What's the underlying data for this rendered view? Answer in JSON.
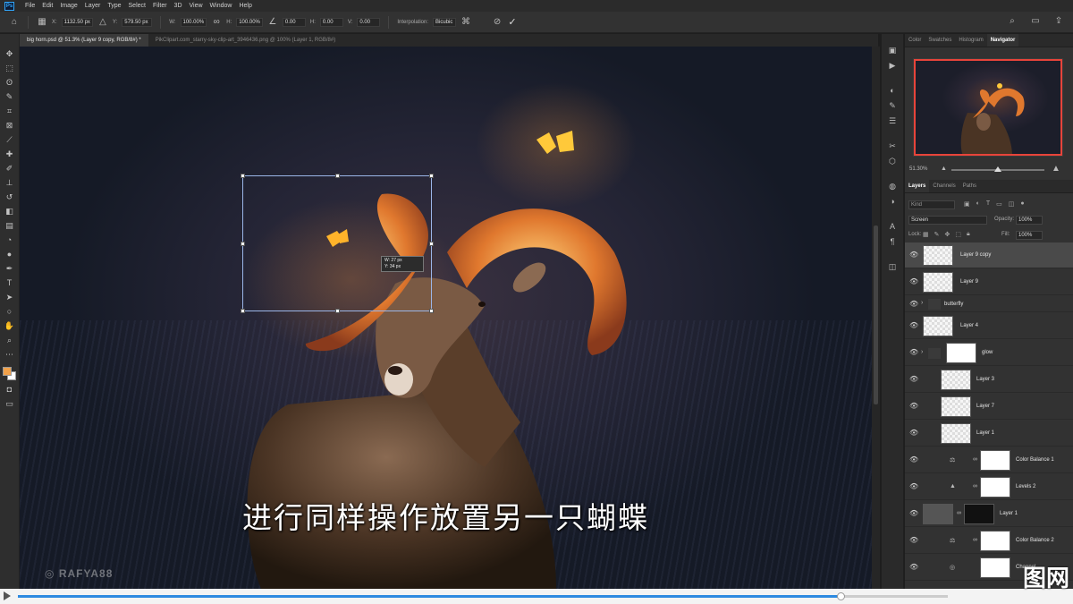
{
  "menubar": {
    "app_icon": "Ps",
    "items": [
      "File",
      "Edit",
      "Image",
      "Layer",
      "Type",
      "Select",
      "Filter",
      "3D",
      "View",
      "Window",
      "Help"
    ]
  },
  "options": {
    "x_value": "1132.50 px",
    "y_value": "579.50 px",
    "w_value": "100.00%",
    "h_value": "100.00%",
    "angle_value": "0.00",
    "h_skew_value": "0.00",
    "v_skew_value": "0.00",
    "interpolation_label": "Interpolation:",
    "interpolation_value": "Bicubic"
  },
  "tabs": [
    "big horn.psd @ 51.3% (Layer 9 copy, RGB/8#) *",
    "PikClipart.com_starry-sky-clip-art_3946436.png @ 100% (Layer 1, RGB/8#)"
  ],
  "canvas": {
    "transform_tip_line1": "W: 27 px",
    "transform_tip_line2": "Y: 34 px",
    "subtitle": "进行同样操作放置另一只蝴蝶",
    "watermark": "RAFYA88"
  },
  "panels": {
    "top_tabs": [
      "Color",
      "Swatches",
      "Histogram",
      "Navigator"
    ],
    "active_top_tab": "Navigator",
    "zoom": "51.30%",
    "layer_tabs": [
      "Layers",
      "Channels",
      "Paths"
    ],
    "search_placeholder": "Kind",
    "blend_mode": "Screen",
    "opacity_label": "Opacity:",
    "opacity_value": "100%",
    "lock_label": "Lock:",
    "fill_label": "Fill:",
    "fill_value": "100%"
  },
  "layers": [
    {
      "name": "Layer 9 copy",
      "thumb": "checker",
      "selected": true
    },
    {
      "name": "Layer 9",
      "thumb": "checker"
    },
    {
      "name": "butterfly",
      "thumb": "folder"
    },
    {
      "name": "Layer 4",
      "thumb": "checker"
    },
    {
      "name": "glow",
      "thumb": "white"
    },
    {
      "name": "Layer 3",
      "thumb": "checker"
    },
    {
      "name": "Layer 7",
      "thumb": "checker"
    },
    {
      "name": "Layer 1",
      "thumb": "checker"
    },
    {
      "name": "Color Balance 1",
      "thumb": "white"
    },
    {
      "name": "Levels 2",
      "thumb": "white"
    },
    {
      "name": "Layer 1",
      "thumb": "dark"
    },
    {
      "name": "Color Balance 2",
      "thumb": "white"
    },
    {
      "name": "Channel",
      "thumb": "white"
    }
  ],
  "video": {
    "progress": 0.885,
    "logo_text": "图网"
  },
  "colors": {
    "foreground": "#f1a14a",
    "background": "#ffffff",
    "navigator_frame": "#e8443a",
    "progress": "#2d8ae0"
  }
}
